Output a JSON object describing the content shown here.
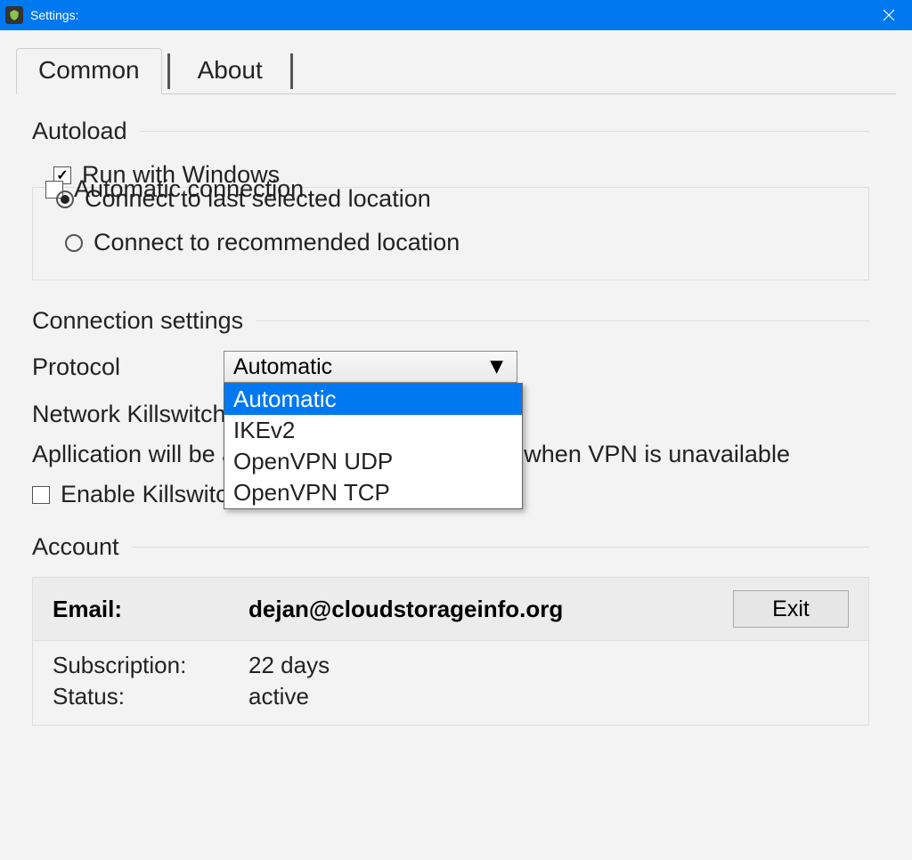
{
  "window": {
    "title": "Settings:",
    "icon": "shield-icon"
  },
  "tabs": {
    "common": "Common",
    "about": "About"
  },
  "autoload": {
    "title": "Autoload",
    "run_with_windows": "Run with Windows",
    "automatic_connection": "Automatic connection",
    "connect_last": "Connect to last selected location",
    "connect_recommended": "Connect to recommended location"
  },
  "connection": {
    "title": "Connection settings",
    "protocol_label": "Protocol",
    "protocol_selected": "Automatic",
    "protocol_options": [
      "Automatic",
      "IKEv2",
      "OpenVPN UDP",
      "OpenVPN TCP"
    ],
    "killswitch_label": "Network Killswitch",
    "killswitch_desc": "Apllication will be automatically disconnected, when VPN is unavailable",
    "enable_killswitch": "Enable Killswitch"
  },
  "account": {
    "title": "Account",
    "email_label": "Email:",
    "email_value": "dejan@cloudstorageinfo.org",
    "exit_label": "Exit",
    "subscription_label": "Subscription:",
    "subscription_value": "22 days",
    "status_label": "Status:",
    "status_value": "active"
  }
}
